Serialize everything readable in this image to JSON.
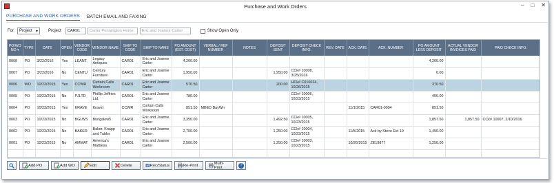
{
  "window": {
    "title": "Purchase and Work Orders",
    "controls": [
      "–",
      "□",
      "✕"
    ]
  },
  "tabs": [
    {
      "label": "PURCHASE AND WORK ORDERS"
    },
    {
      "label": "BATCH EMAIL AND FAXING"
    }
  ],
  "filters": {
    "for_label": "For",
    "for_value": "Project",
    "project_label": "Project",
    "project_code": "CAR01",
    "project_name_placeholder": "Carter Pennington Home",
    "client_placeholder": "Eric and Joanne Carter",
    "show_open_label": "Show Open Only"
  },
  "table": {
    "columns": [
      "PO/WO NO ▾",
      "TYPE",
      "DATE",
      "OPEN",
      "VENDOR CODE",
      "VENDOR NAME",
      "SHIP TO CODE",
      "SHIP TO NAME",
      "PO AMOUNT (EST. COST)",
      "VERBAL / REF NUMBER",
      "NOTES",
      "DEPOSIT SENT",
      "DEPOSIT CHECK INFO.",
      "REV. DATE",
      "ACK. DATE",
      "ACK. NUMBER",
      "PO AMOUNT LESS DEPOSIT",
      "ACTUAL VENDOR INVOICES PAID",
      "PAID CHECK INFO."
    ],
    "rows": [
      [
        "0008",
        "PO",
        "3/22/2016",
        "Yes",
        "LEANT",
        "Legacy Antiques",
        "CAR01",
        "Eric and Joanne Carter",
        "4,200.00",
        "",
        "",
        "",
        "",
        "",
        "",
        "",
        "4,200.00",
        "",
        ""
      ],
      [
        "0007",
        "PO",
        "3/22/2016",
        "No",
        "CENTU",
        "Century Furniture",
        "CAR01",
        "Eric and Joanne Carter",
        "1,950.00",
        "",
        "",
        "1,950.00",
        "CCk# 10008, 3/25/2016",
        "",
        "",
        "",
        "0.00",
        "",
        ""
      ],
      [
        "0006",
        "WO",
        "10/23/2015",
        "Yes",
        "CCWR",
        "Curtain Calls Workroom",
        "CAR01",
        "Eric and Joanne Carter",
        "570.50",
        "",
        "",
        "200.00",
        "HCk# C010024, 10/26/2015",
        "",
        "",
        "",
        "370.50",
        "",
        ""
      ],
      [
        "0005",
        "PO",
        "10/23/2015",
        "No",
        "PJLTD",
        "Phillip Jeffries Ltd.",
        "CAR01",
        "Eric and Joanne Carter",
        "780.00",
        "",
        "",
        "",
        "CCk# 10006, 10/23/2015",
        "",
        "",
        "",
        "400.00",
        "",
        ""
      ],
      [
        "0004",
        "PO",
        "10/23/2015",
        "Yes",
        "KRAVE",
        "Kravet",
        "CCWR",
        "Curtain Calls Workroom",
        "851.50",
        "MBED BayWn",
        "",
        "",
        "",
        "",
        "11/1/2015",
        "CAR01-0004",
        "851.50",
        "",
        ""
      ],
      [
        "0003",
        "PO",
        "10/23/2015",
        "No",
        "BGLWS",
        "Bungalow5",
        "CAR01",
        "Eric and Joanne Carter",
        "3,350.00",
        "",
        "",
        "1,492.50",
        "CCk# 10005, 10/23/2015",
        "",
        "",
        "",
        "1,857.50",
        "1,857.50",
        "CCk# 10007, 2/10/2016"
      ],
      [
        "0002",
        "PO",
        "10/23/2015",
        "No",
        "BAKER",
        "Baker, Knapp and Tubbs",
        "CAR01",
        "Eric and Joanne Carter",
        "2,700.00",
        "",
        "",
        "1,250.00",
        "CCk# 10004, 10/23/2015",
        "",
        "11/5/2015",
        "Ack by Steve Ext 10",
        "1,450.00",
        "",
        ""
      ],
      [
        "0001",
        "PO",
        "10/23/2015",
        "No",
        "AMMAT",
        "America's Mattress",
        "CAR01",
        "Eric and Joanne Carter",
        "2,500.00",
        "",
        "",
        "1,250.00",
        "CCk# 10003, 10/23/2015",
        "",
        "10/26/2015",
        "ZE19877",
        "1,250.00",
        "",
        ""
      ]
    ]
  },
  "toolbar": {
    "search": "",
    "add_po": "Add PO",
    "add_wo": "Add WO",
    "edit": "Edit",
    "delete": "Delete",
    "rec_status": "Rec/Status",
    "reprint": "Re-Print",
    "multi_print": "Multi-Print",
    "help": "?"
  },
  "colors": {
    "header": "#5b6f86",
    "selected_row": "#bcd3e2",
    "accent": "#2a5ea8"
  },
  "icons": [
    "app-icon",
    "search-icon",
    "add-po-icon",
    "add-wo-icon",
    "edit-icon",
    "delete-icon",
    "rec-status-icon",
    "reprint-icon",
    "multi-print-icon",
    "help-icon"
  ]
}
